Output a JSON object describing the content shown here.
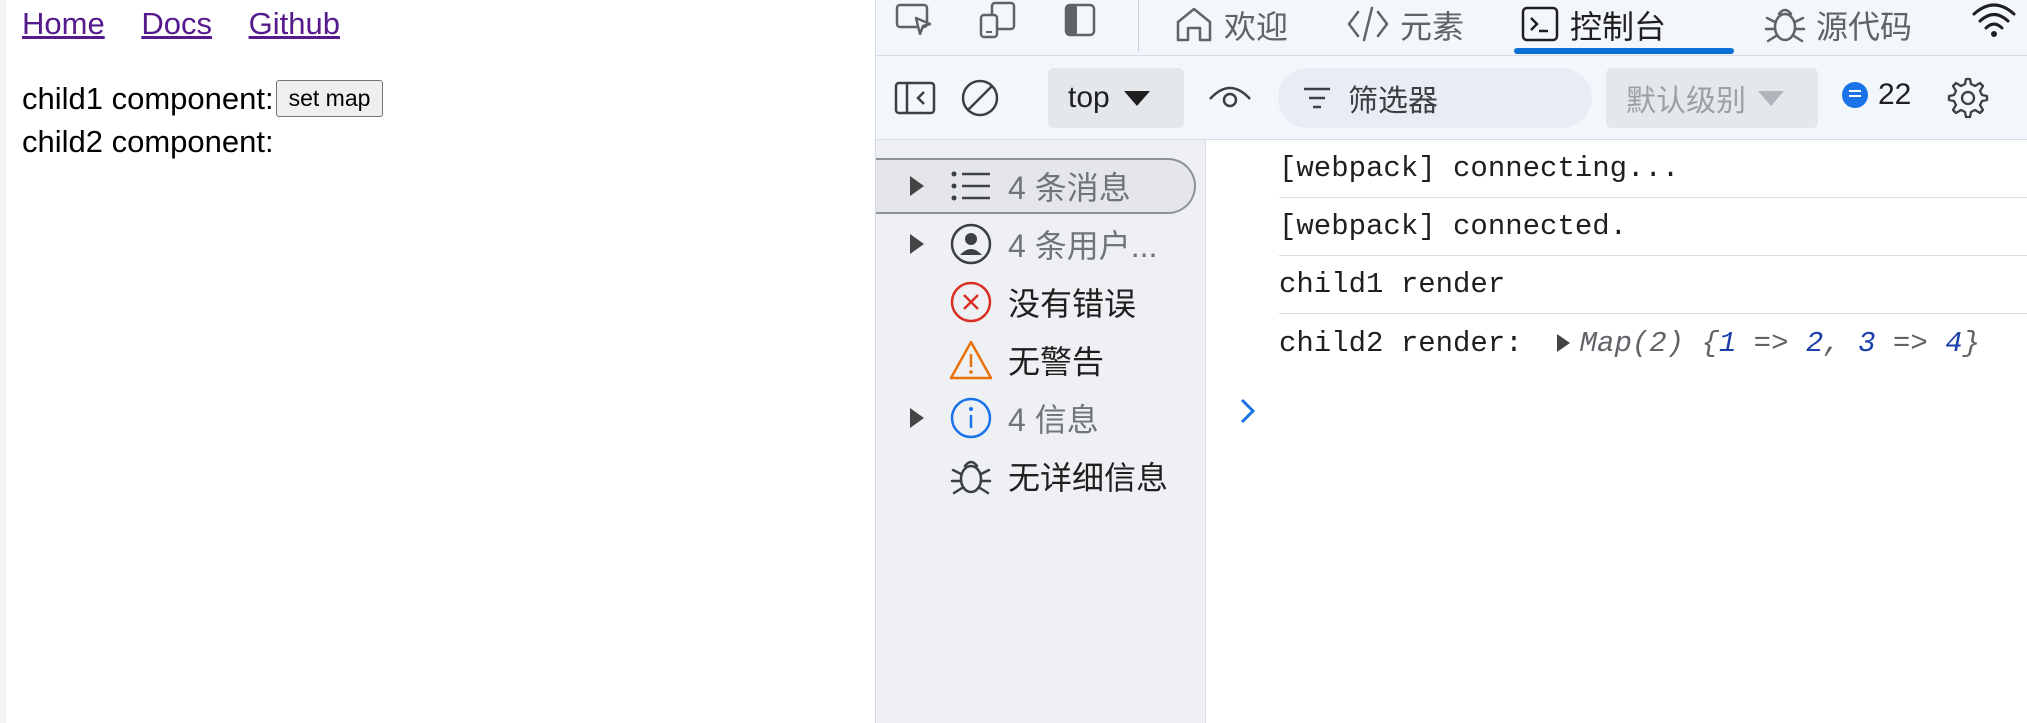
{
  "page": {
    "nav": [
      "Home",
      "Docs",
      "Github"
    ],
    "child1_label": "child1 component:",
    "set_map_button": "set map",
    "child2_label": "child2 component:"
  },
  "devtools": {
    "tabs": {
      "welcome": "欢迎",
      "elements": "元素",
      "console": "控制台",
      "sources": "源代码"
    },
    "toolbar": {
      "context": "top",
      "filter_placeholder": "筛选器",
      "level": "默认级别",
      "issues_count": "22"
    },
    "sidebar": {
      "messages": "4 条消息",
      "user_messages": "4 条用户...",
      "errors": "没有错误",
      "warnings": "无警告",
      "info": "4 信息",
      "verbose": "无详细信息"
    },
    "console": {
      "line1": "[webpack] connecting...",
      "line2": "[webpack] connected.",
      "line3": "child1 render",
      "line4_prefix": "child2 render:",
      "map_head": "Map(2) {",
      "map_k1": "1",
      "map_arrow1": " => ",
      "map_v1": "2",
      "map_sep": ", ",
      "map_k2": "3",
      "map_arrow2": " => ",
      "map_v2": "4",
      "map_tail": "}"
    },
    "colors": {
      "accent": "#0b6fd6",
      "error": "#d93025",
      "warning": "#e8710a",
      "info": "#1a73e8"
    }
  }
}
